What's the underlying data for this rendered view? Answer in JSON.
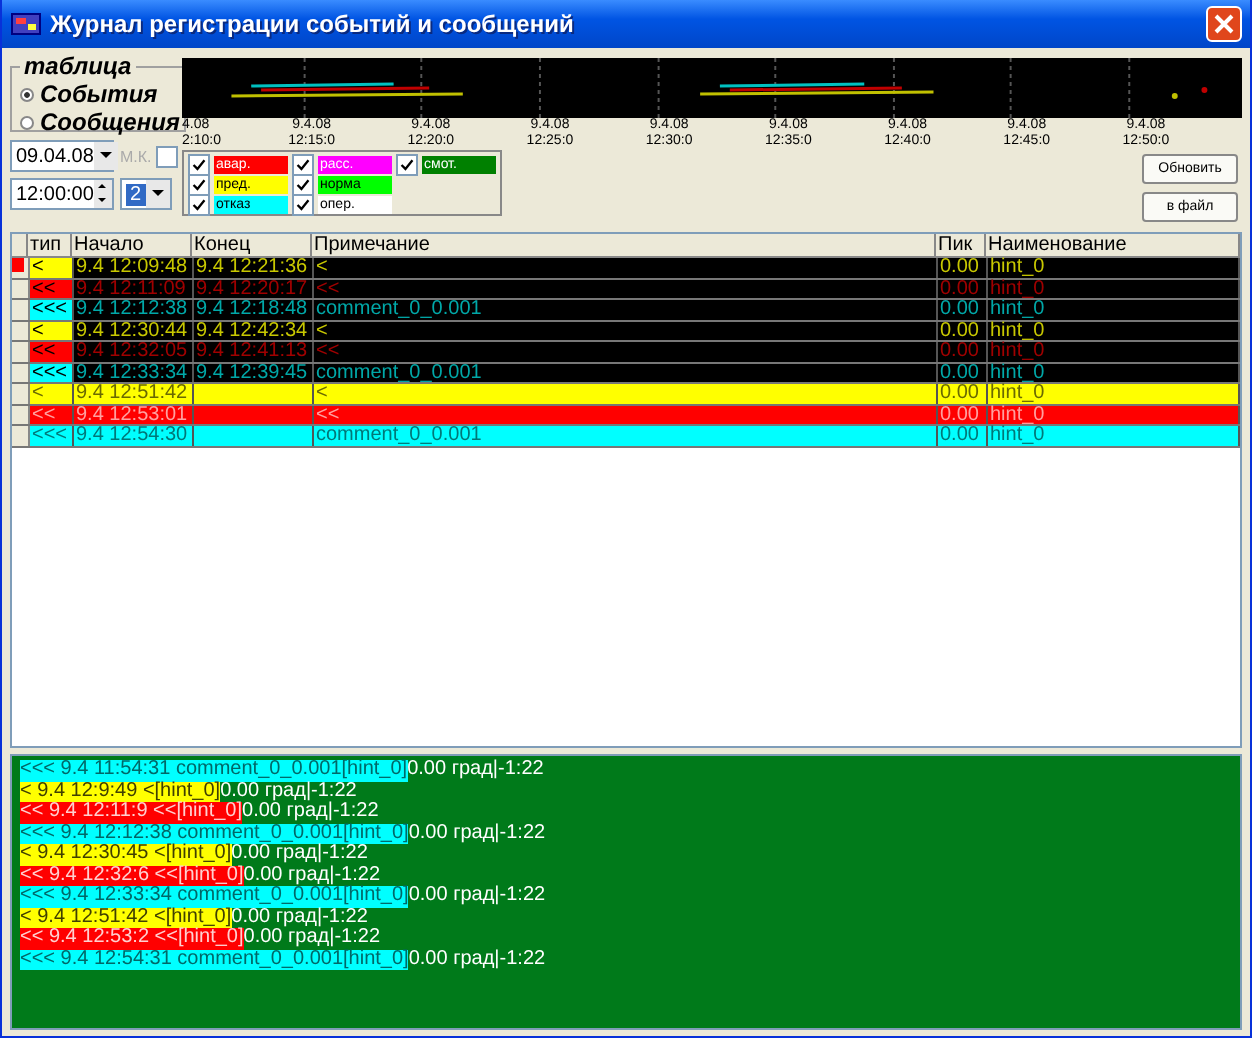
{
  "window": {
    "title": "Журнал регистрации событий и сообщений"
  },
  "table_group": {
    "title": "таблица",
    "options": [
      {
        "label": "События",
        "selected": true
      },
      {
        "label": "Сообщения",
        "selected": false
      }
    ]
  },
  "timeline": {
    "ticks": [
      {
        "date": "4.08",
        "time": "2:10:0"
      },
      {
        "date": "9.4.08",
        "time": "12:15:0"
      },
      {
        "date": "9.4.08",
        "time": "12:20:0"
      },
      {
        "date": "9.4.08",
        "time": "12:25:0"
      },
      {
        "date": "9.4.08",
        "time": "12:30:0"
      },
      {
        "date": "9.4.08",
        "time": "12:35:0"
      },
      {
        "date": "9.4.08",
        "time": "12:40:0"
      },
      {
        "date": "9.4.08",
        "time": "12:45:0"
      },
      {
        "date": "9.4.08",
        "time": "12:50:0"
      }
    ]
  },
  "date": "09.04.08",
  "time": "12:00:00",
  "mk": {
    "label": "М.К.",
    "checked": false,
    "disabled": true
  },
  "count": "2",
  "legend": [
    {
      "label": "авар.",
      "checked": true,
      "color": "#ff0000"
    },
    {
      "label": "пред.",
      "checked": true,
      "color": "#ffff00"
    },
    {
      "label": "отказ",
      "checked": true,
      "color": "#00ffff"
    },
    {
      "label": "расс.",
      "checked": true,
      "color": "#ff00ff"
    },
    {
      "label": "норма",
      "checked": true,
      "color": "#00ff00"
    },
    {
      "label": "опер.",
      "checked": true,
      "color": "#ffffff"
    },
    {
      "label": "смот.",
      "checked": true,
      "color": "#008000"
    }
  ],
  "buttons": [
    "Обновить",
    "в файл"
  ],
  "table": {
    "columns": [
      "тип",
      "Начало",
      "Конец",
      "Примечание",
      "Пик",
      "Наименование"
    ],
    "rows": [
      {
        "kind": "warn",
        "filled": false,
        "current": true,
        "type": "<",
        "start": "9.4 12:09:48",
        "end": "9.4 12:21:36",
        "note": "<",
        "peak": "0.00",
        "name": "hint_0"
      },
      {
        "kind": "alarm",
        "filled": false,
        "current": false,
        "type": "<<",
        "start": "9.4 12:11:09",
        "end": "9.4 12:20:17",
        "note": "<<",
        "peak": "0.00",
        "name": "hint_0"
      },
      {
        "kind": "fail",
        "filled": false,
        "current": false,
        "type": "<<<",
        "start": "9.4 12:12:38",
        "end": "9.4 12:18:48",
        "note": "comment_0_0.001",
        "peak": "0.00",
        "name": "hint_0"
      },
      {
        "kind": "warn",
        "filled": false,
        "current": false,
        "type": "<",
        "start": "9.4 12:30:44",
        "end": "9.4 12:42:34",
        "note": "<",
        "peak": "0.00",
        "name": "hint_0"
      },
      {
        "kind": "alarm",
        "filled": false,
        "current": false,
        "type": "<<",
        "start": "9.4 12:32:05",
        "end": "9.4 12:41:13",
        "note": "<<",
        "peak": "0.00",
        "name": "hint_0"
      },
      {
        "kind": "fail",
        "filled": false,
        "current": false,
        "type": "<<<",
        "start": "9.4 12:33:34",
        "end": "9.4 12:39:45",
        "note": "comment_0_0.001",
        "peak": "0.00",
        "name": "hint_0"
      },
      {
        "kind": "warn",
        "filled": true,
        "current": false,
        "type": "<",
        "start": "9.4 12:51:42",
        "note": "<",
        "peak": "0.00",
        "name": "hint_0"
      },
      {
        "kind": "alarm",
        "filled": true,
        "current": false,
        "type": "<<",
        "start": "9.4 12:53:01",
        "note": "<<",
        "peak": "0.00",
        "name": "hint_0"
      },
      {
        "kind": "fail",
        "filled": true,
        "current": false,
        "type": "<<<",
        "start": "9.4 12:54:30",
        "note": "comment_0_0.001",
        "peak": "0.00",
        "name": "hint_0"
      }
    ]
  },
  "log": [
    {
      "kind": "fail",
      "tag": "<<< 9.4 11:54:31 comment_0_0.001[hint_0]",
      "rest": "0.00 град|-1:22"
    },
    {
      "kind": "warn",
      "tag": "< 9.4 12:9:49 <[hint_0]",
      "rest": "0.00 град|-1:22"
    },
    {
      "kind": "alarm",
      "tag": "<< 9.4 12:11:9 <<[hint_0]",
      "rest": "0.00 град|-1:22"
    },
    {
      "kind": "fail",
      "tag": "<<< 9.4 12:12:38 comment_0_0.001[hint_0]",
      "rest": "0.00 град|-1:22"
    },
    {
      "kind": "warn",
      "tag": "< 9.4 12:30:45 <[hint_0]",
      "rest": "0.00 град|-1:22"
    },
    {
      "kind": "alarm",
      "tag": "<< 9.4 12:32:6 <<[hint_0]",
      "rest": "0.00 град|-1:22"
    },
    {
      "kind": "fail",
      "tag": "<<< 9.4 12:33:34 comment_0_0.001[hint_0]",
      "rest": "0.00 град|-1:22"
    },
    {
      "kind": "warn",
      "tag": "< 9.4 12:51:42 <[hint_0]",
      "rest": "0.00 град|-1:22"
    },
    {
      "kind": "alarm",
      "tag": "<< 9.4 12:53:2 <<[hint_0]",
      "rest": "0.00 град|-1:22"
    },
    {
      "kind": "fail",
      "tag": "<<< 9.4 12:54:31 comment_0_0.001[hint_0]",
      "rest": "0.00 град|-1:22"
    }
  ]
}
